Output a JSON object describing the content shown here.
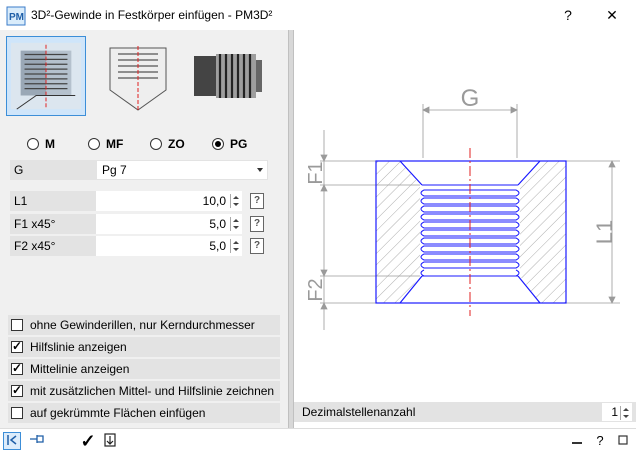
{
  "window": {
    "title": "3D²-Gewinde in Festkörper einfügen   -   PM3D²",
    "help_label": "?",
    "close_label": "✕"
  },
  "thread_types": {
    "options": [
      {
        "label": "M",
        "selected": false
      },
      {
        "label": "MF",
        "selected": false
      },
      {
        "label": "ZO",
        "selected": false
      },
      {
        "label": "PG",
        "selected": true
      }
    ]
  },
  "fields": {
    "g": {
      "label": "G",
      "value": "Pg 7"
    },
    "l1": {
      "label": "L1",
      "value": "10,0"
    },
    "f1": {
      "label": "F1  x45°",
      "value": "5,0"
    },
    "f2": {
      "label": "F2  x45°",
      "value": "5,0"
    }
  },
  "options": [
    {
      "label": "ohne Gewinderillen, nur Kerndurchmesser",
      "checked": false
    },
    {
      "label": "Hilfslinie anzeigen",
      "checked": true
    },
    {
      "label": "Mittelinie anzeigen",
      "checked": true
    },
    {
      "label": "mit zusätzlichen Mittel- und Hilfslinie zeichnen",
      "checked": true
    },
    {
      "label": "auf gekrümmte Flächen einfügen",
      "checked": false
    }
  ],
  "drawing": {
    "label_g": "G",
    "label_f1": "F1",
    "label_f2": "F2",
    "label_l1": "L1"
  },
  "decimals": {
    "label": "Dezimalstellenanzahl",
    "value": "1"
  },
  "colors": {
    "accent": "#3c8ed8",
    "outline": "#1a1aff",
    "center_line": "#e02020",
    "dimension": "#9a9a9a"
  }
}
